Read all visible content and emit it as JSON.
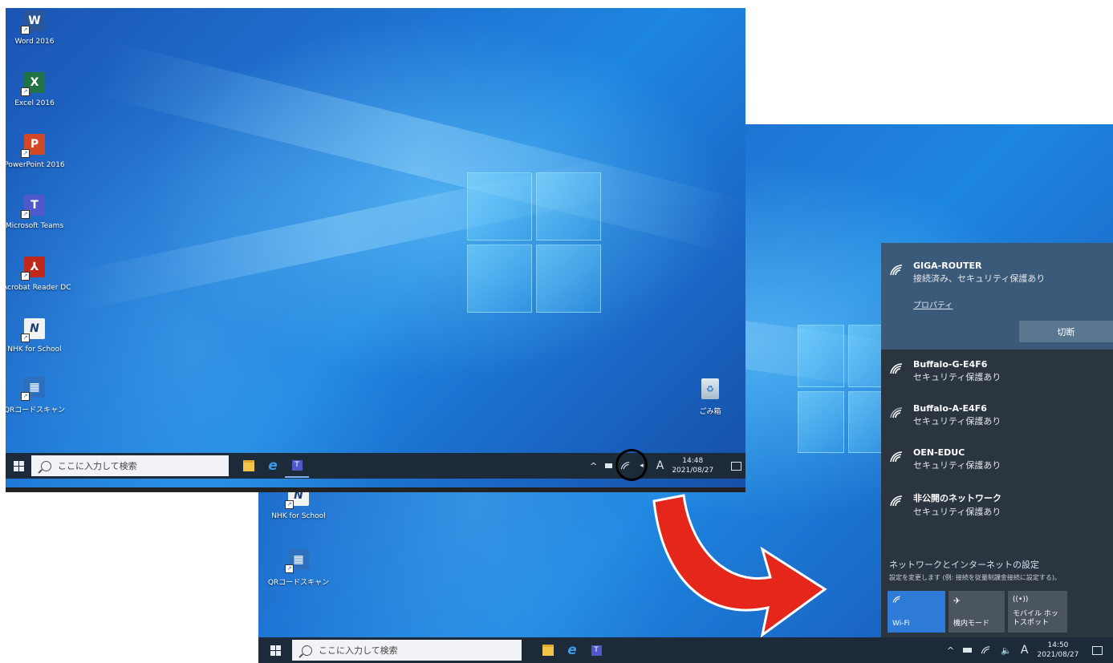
{
  "desktop_icons": [
    {
      "name": "word-icon",
      "label": "Word 2016",
      "glyph": "W",
      "color": "#2b579a"
    },
    {
      "name": "excel-icon",
      "label": "Excel 2016",
      "glyph": "X",
      "color": "#217346"
    },
    {
      "name": "powerpoint-icon",
      "label": "PowerPoint 2016",
      "glyph": "P",
      "color": "#d24726"
    },
    {
      "name": "teams-icon",
      "label": "Microsoft Teams",
      "glyph": "T",
      "color": "#5059c9"
    },
    {
      "name": "acrobat-icon",
      "label": "Acrobat Reader DC",
      "glyph": "★",
      "color": "#c1281c"
    },
    {
      "name": "nhk-icon",
      "label": "NHK for School",
      "glyph": "N",
      "color": "#f2f2f2"
    },
    {
      "name": "qr-icon",
      "label": "QRコードスキャン",
      "glyph": "▦",
      "color": "#2c6fbf"
    }
  ],
  "recycle_bin_label": "ごみ箱",
  "screen1_taskbar": {
    "search_placeholder": "ここに入力して検索",
    "time": "14:48",
    "date": "2021/08/27",
    "ime": "A"
  },
  "screen2_taskbar": {
    "search_placeholder": "ここに入力して検索",
    "time": "14:50",
    "date": "2021/08/27",
    "ime": "A"
  },
  "screen2_desktop": {
    "nhk_label": "NHK for School",
    "qr_label": "QRコードスキャン"
  },
  "network_flyout": {
    "connected": {
      "ssid": "GIGA-ROUTER",
      "status": "接続済み、セキュリティ保護あり",
      "properties_link": "プロパティ",
      "disconnect_label": "切断"
    },
    "networks": [
      {
        "ssid": "Buffalo-G-E4F6",
        "status": "セキュリティ保護あり"
      },
      {
        "ssid": "Buffalo-A-E4F6",
        "status": "セキュリティ保護あり"
      },
      {
        "ssid": "OEN-EDUC",
        "status": "セキュリティ保護あり"
      },
      {
        "ssid": "非公開のネットワーク",
        "status": "セキュリティ保護あり"
      }
    ],
    "settings_title": "ネットワークとインターネットの設定",
    "settings_desc": "設定を変更します (例: 接続を従量制課金接続に設定する)。",
    "quick_actions": [
      {
        "label": "Wi-Fi",
        "active": true
      },
      {
        "label": "機内モード",
        "active": false
      },
      {
        "label": "モバイル ホットスポット",
        "active": false
      }
    ]
  },
  "colors": {
    "arrow": "#e5261b",
    "wifi_active": "#2d7bd6",
    "taskbar": "#1d2a3a"
  }
}
